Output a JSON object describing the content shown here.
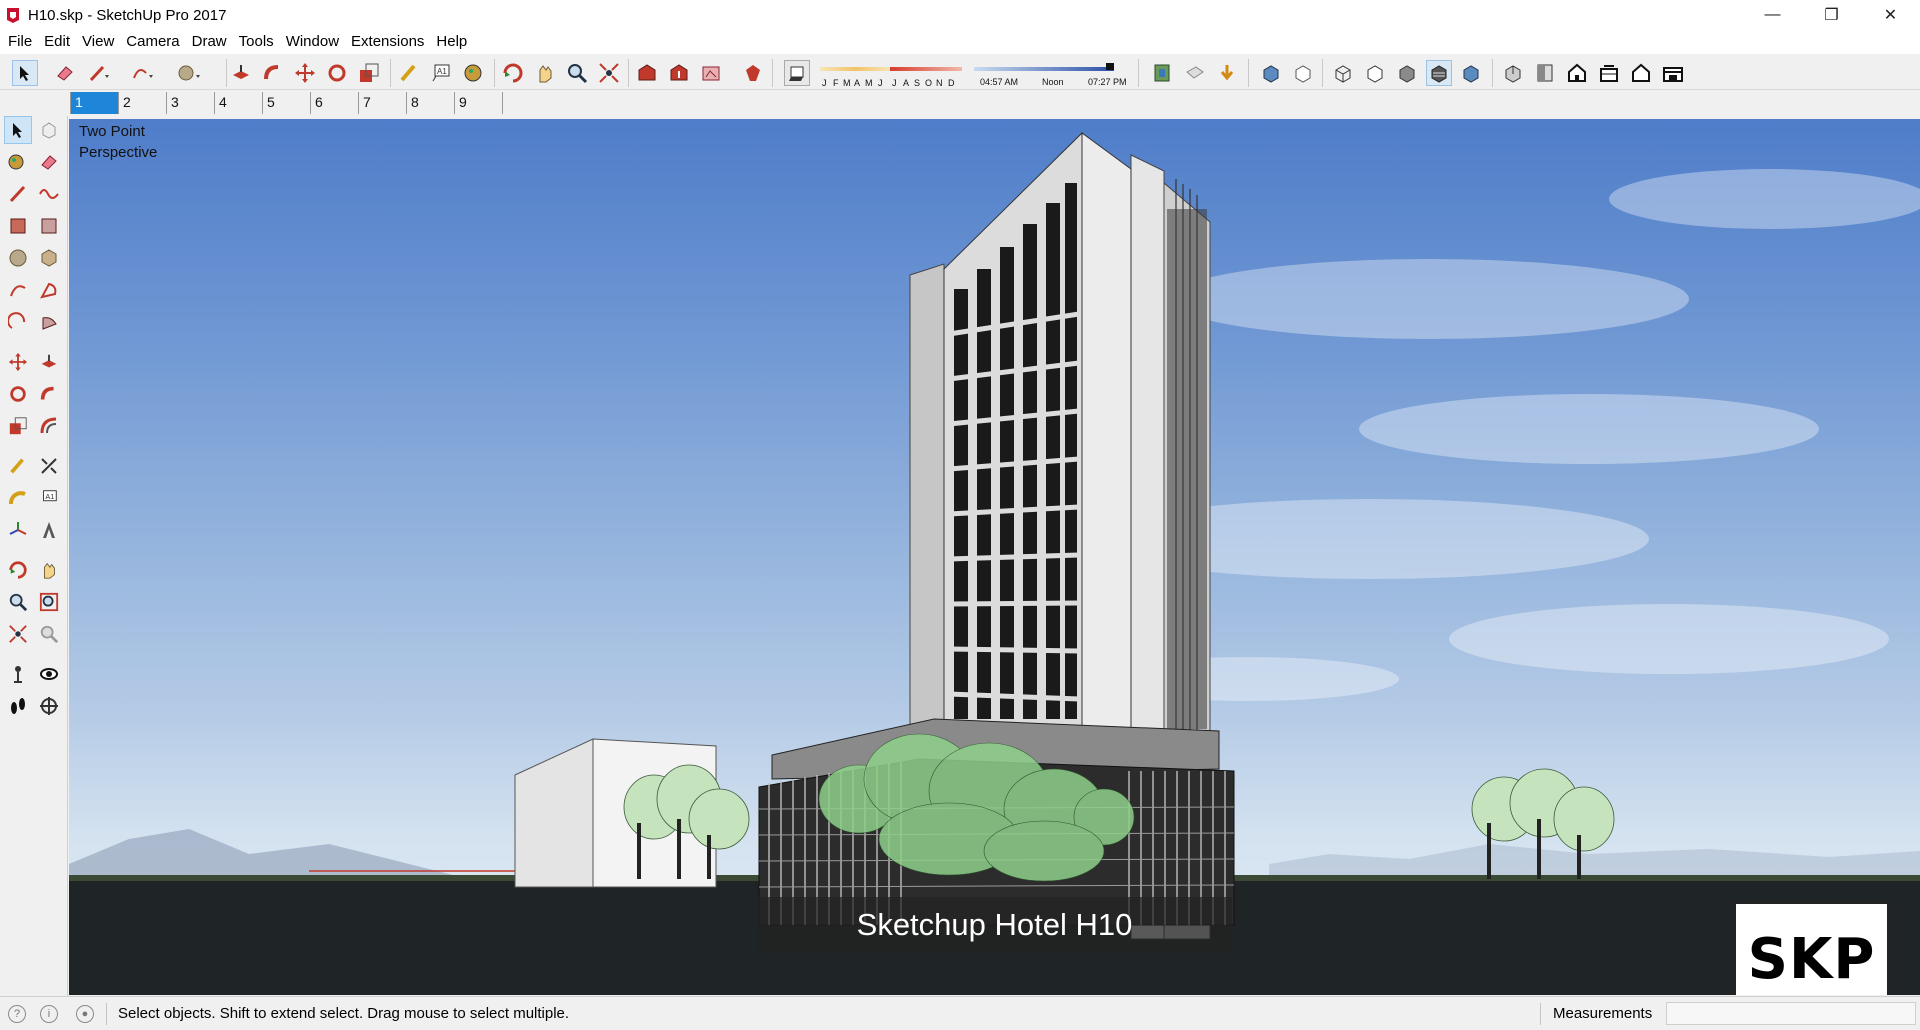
{
  "window": {
    "title": "H10.skp - SketchUp Pro 2017",
    "minimize_glyph": "—",
    "maximize_glyph": "❐",
    "close_glyph": "✕"
  },
  "menu": [
    "File",
    "Edit",
    "View",
    "Camera",
    "Draw",
    "Tools",
    "Window",
    "Extensions",
    "Help"
  ],
  "toolbar": {
    "months": [
      "J",
      "F",
      "M",
      "A",
      "M",
      "J",
      "J",
      "A",
      "S",
      "O",
      "N",
      "D"
    ],
    "time_start": "04:57 AM",
    "time_mid": "Noon",
    "time_end": "07:27 PM"
  },
  "scenes": {
    "tabs": [
      "1",
      "2",
      "3",
      "4",
      "5",
      "6",
      "7",
      "8",
      "9"
    ],
    "active_index": 0
  },
  "viewport": {
    "camera_label": "Two Point\nPerspective",
    "caption": "Sketchup Hotel H10",
    "badge": "SKP"
  },
  "statusbar": {
    "message": "Select objects. Shift to extend select. Drag mouse to select multiple.",
    "measurements_label": "Measurements",
    "measurements_value": ""
  },
  "colors": {
    "accent_tab": "#1e86d8",
    "sky_top": "#4f7dc9",
    "sky_bottom": "#e6eef6",
    "tree_green": "#8fd08a",
    "badge_underline": "#4b1f5e"
  }
}
